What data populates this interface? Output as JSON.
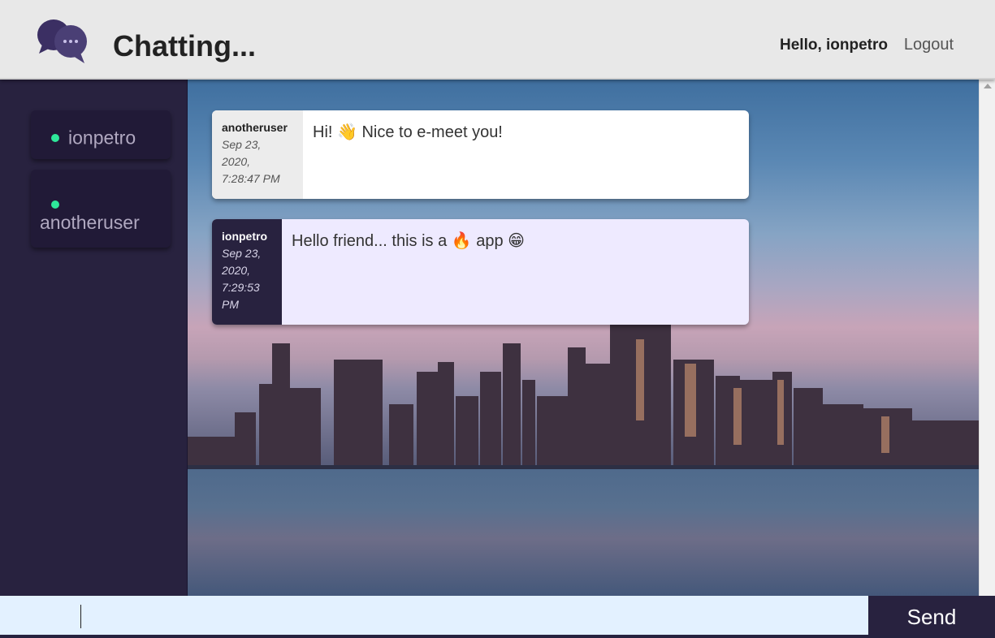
{
  "header": {
    "title": "Chatting...",
    "greeting": "Hello, ionpetro",
    "logout_label": "Logout"
  },
  "sidebar": {
    "users": [
      {
        "name": "ionpetro",
        "status": "online"
      },
      {
        "name": "anotheruser",
        "status": "online"
      }
    ]
  },
  "messages": [
    {
      "author": "anotheruser",
      "time_lines": [
        "Sep 23,",
        "2020,",
        "7:28:47 PM"
      ],
      "text": "Hi! 👋 Nice to e-meet you!"
    },
    {
      "author": "ionpetro",
      "time_lines": [
        "Sep 23,",
        "2020,",
        "7:29:53",
        "PM"
      ],
      "text": "Hello friend... this is a 🔥 app 😁"
    }
  ],
  "composer": {
    "value": "",
    "send_label": "Send"
  },
  "colors": {
    "header_bg": "#e8e8e8",
    "sidebar_bg": "#28223f",
    "online": "#2ee89a",
    "own_message_bg": "#eeeaff",
    "composer_bg": "#e3f1ff"
  }
}
